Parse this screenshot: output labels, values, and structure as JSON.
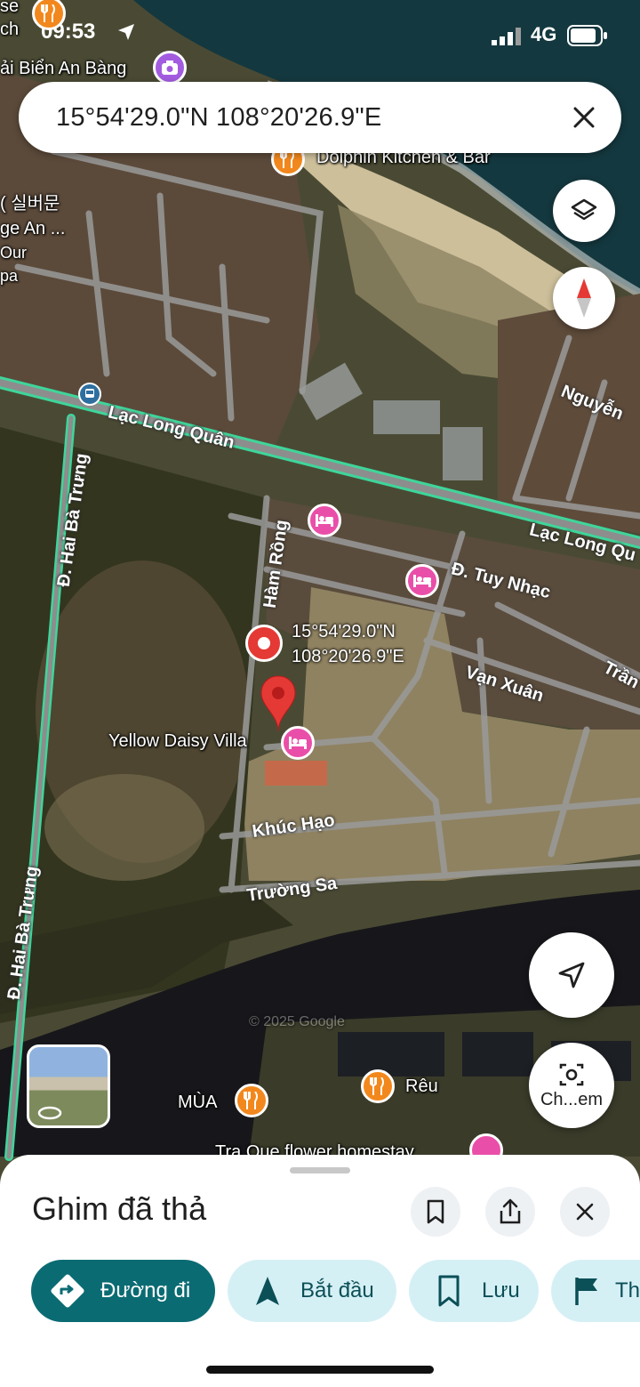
{
  "status_bar": {
    "time": "09:53",
    "network": "4G"
  },
  "search": {
    "query": "15°54'29.0\"N 108°20'26.9\"E"
  },
  "map": {
    "labels": {
      "beach_photo": "ải Biển An Bàng",
      "dolphin": "Dolphin Kitchen & Bar",
      "korean": "( 실버문",
      "village": "ge An ...",
      "our": "Our",
      "pa": "pa",
      "sch": "se",
      "ch": "ch",
      "yellow_daisy": "Yellow Daisy Villa",
      "mua": "MÙA",
      "reu": "Rêu",
      "tra_que": "Tra Que flower homestay"
    },
    "roads": {
      "lac_long_quan_1": "Lạc Long Quân",
      "lac_long_quan_2": "Lạc Long Qu",
      "hai_ba_trung_1": "Đ. Hai Bà Trưng",
      "hai_ba_trung_2": "Đ. Hai Bà Trưng",
      "ham_rong": "Hàm Rồng",
      "tuy_nhac": "Đ. Tuy Nhạc",
      "van_xuan": "Vạn Xuân",
      "tran": "Trần",
      "nguyen": "Nguyễn",
      "khuc_hao": "Khúc Hạo",
      "truong_sa": "Trường Sa"
    },
    "pin_coords": {
      "lat": "15°54'29.0\"N",
      "lng": "108°20'26.9\"E"
    },
    "watermark": "© 2025 Google"
  },
  "buttons": {
    "lens_label": "Ch...em"
  },
  "sheet": {
    "title": "Ghim đã thả",
    "chips": {
      "directions": "Đường đi",
      "start": "Bắt đầu",
      "save": "Lưu",
      "flag": "Th"
    }
  },
  "colors": {
    "primary": "#0b6b73",
    "chip_secondary": "#d5f0f5",
    "pin": "#e53935",
    "road_major": "#35c38a",
    "hotel_poi": "#e94fa9",
    "food_poi": "#f2881d"
  }
}
